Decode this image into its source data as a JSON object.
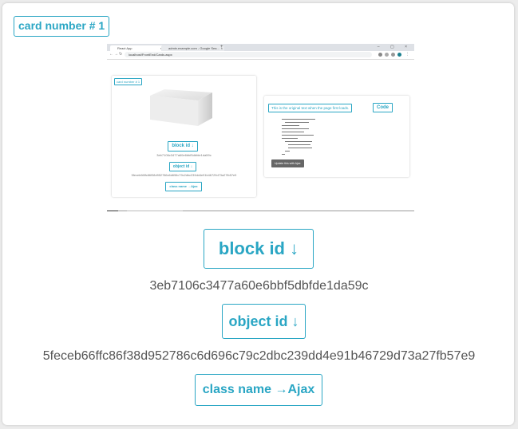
{
  "card": {
    "tag_label": "card number # 1"
  },
  "screenshot": {
    "tab1_title": "React App",
    "tab2_title": "admin.example.com - Google Sea...",
    "url": "localhost/FrontEnd/Cards.aspx",
    "inner_tag": "card number # 1",
    "inner_block_id": "block id ↓",
    "inner_block_hash": "3eb7106c3477a60e6bbf5dbfde1da59c",
    "inner_object_id": "object id ↓",
    "inner_object_hash": "5feceb66ffc86f38d952786c6d696c79c2dbc239dd4e91b46729d73a27fb57e9",
    "inner_class_name": "class name →Ajax",
    "original_text": "This is the original text when the page first loads.",
    "code_label": "Code",
    "update_label": "Update this with Ajax"
  },
  "block": {
    "label": "block id ↓",
    "hash": "3eb7106c3477a60e6bbf5dbfde1da59c"
  },
  "object": {
    "label": "object id ↓",
    "hash": "5feceb66ffc86f38d952786c6d696c79c2dbc239dd4e91b46729d73a27fb57e9"
  },
  "class_name": {
    "label": "class name →Ajax"
  },
  "colors": {
    "accent": "#2aa6c4",
    "text": "#555555",
    "background": "#ececec"
  }
}
